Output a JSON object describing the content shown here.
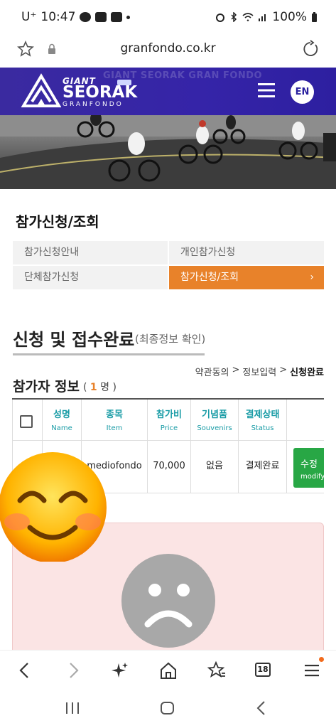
{
  "status_bar": {
    "carrier": "U⁺",
    "time": "10:47",
    "battery": "100%"
  },
  "browser": {
    "url": "granfondo.co.kr",
    "tab_count": "18"
  },
  "site": {
    "ghost_text": "GIANT SEORAK GRAN FONDO",
    "logo_giant": "GIANT",
    "logo_seorak": "SEORAK",
    "logo_granfondo": "GRANFONDO",
    "lang_button": "EN"
  },
  "page": {
    "title": "참가신청/조회",
    "tabs": [
      {
        "label": "참가신청안내",
        "active": false
      },
      {
        "label": "개인참가신청",
        "active": false
      },
      {
        "label": "단체참가신청",
        "active": false
      },
      {
        "label": "참가신청/조회",
        "active": true,
        "chevron": "›"
      }
    ],
    "section_title": "신청 및 접수완료",
    "section_sub": "(최종정보 확인)",
    "breadcrumb": [
      "약관동의",
      "정보입력",
      "신청완료"
    ],
    "breadcrumb_sep": ">",
    "participants_title": "참가자 정보",
    "participants_count_open": "(",
    "participants_count": "1",
    "participants_count_unit": "명 )"
  },
  "table": {
    "headers": [
      {
        "ko": "성명",
        "en": "Name"
      },
      {
        "ko": "종목",
        "en": "Item"
      },
      {
        "ko": "참가비",
        "en": "Price"
      },
      {
        "ko": "기념품",
        "en": "Souvenirs"
      },
      {
        "ko": "결제상태",
        "en": "Status"
      }
    ],
    "rows": [
      {
        "name": "",
        "item": "mediofondo",
        "price": "70,000",
        "souvenir": "없음",
        "status": "결제완료",
        "action_ko": "수정",
        "action_en": "modify"
      }
    ]
  },
  "colors": {
    "header_bg": "#3524a8",
    "accent_orange": "#e8822a",
    "teal_header": "#1a9ca6",
    "modify_green": "#28a745",
    "panel_pink": "#fbe4e4"
  },
  "icons": {
    "overlay_emoji": "smiling-face-icon",
    "sad_face": "sad-face-icon"
  }
}
